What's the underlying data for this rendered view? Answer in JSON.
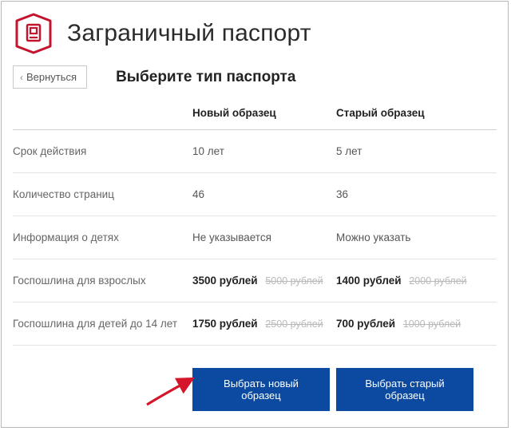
{
  "header": {
    "title": "Заграничный паспорт",
    "back_label": "Вернуться",
    "subtitle": "Выберите тип паспорта"
  },
  "columns": {
    "new": "Новый образец",
    "old": "Старый образец"
  },
  "rows": [
    {
      "label": "Срок действия",
      "new": "10 лет",
      "old": "5 лет"
    },
    {
      "label": "Количество страниц",
      "new": "46",
      "old": "36"
    },
    {
      "label": "Информация о детях",
      "new": "Не указывается",
      "old": "Можно указать"
    }
  ],
  "fee_rows": [
    {
      "label": "Госпошлина для взрослых",
      "new_price": "3500 рублей",
      "new_strike": "5000 рублей",
      "old_price": "1400 рублей",
      "old_strike": "2000 рублей"
    },
    {
      "label": "Госпошлина для детей до 14 лет",
      "new_price": "1750 рублей",
      "new_strike": "2500 рублей",
      "old_price": "700 рублей",
      "old_strike": "1000 рублей"
    }
  ],
  "actions": {
    "choose_new": "Выбрать новый образец",
    "choose_old": "Выбрать старый образец"
  },
  "chart_data": {
    "type": "table",
    "title": "Выберите тип паспорта",
    "columns": [
      "",
      "Новый образец",
      "Старый образец"
    ],
    "rows": [
      [
        "Срок действия",
        "10 лет",
        "5 лет"
      ],
      [
        "Количество страниц",
        "46",
        "36"
      ],
      [
        "Информация о детях",
        "Не указывается",
        "Можно указать"
      ],
      [
        "Госпошлина для взрослых",
        "3500 рублей (5000 рублей)",
        "1400 рублей (2000 рублей)"
      ],
      [
        "Госпошлина для детей до 14 лет",
        "1750 рублей (2500 рублей)",
        "700 рублей (1000 рублей)"
      ]
    ]
  }
}
